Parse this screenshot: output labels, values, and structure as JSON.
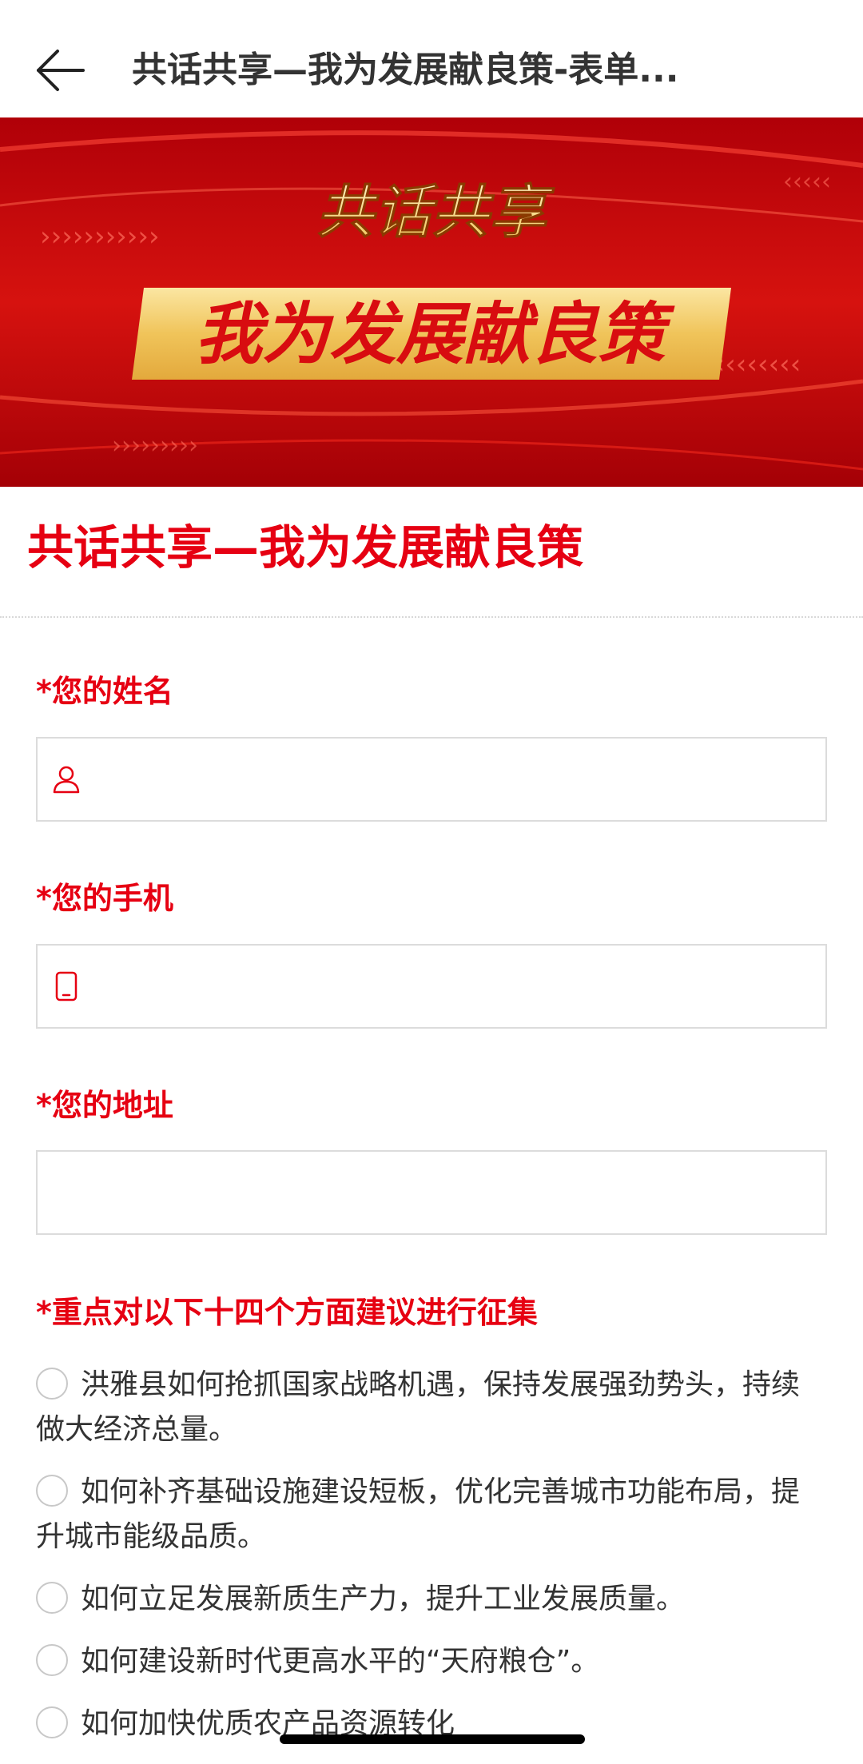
{
  "header": {
    "title": "共话共享—我为发展献良策-表单..."
  },
  "banner": {
    "line1": "共话共享",
    "line2": "我为发展献良策"
  },
  "form": {
    "heading": "共话共享—我为发展献良策",
    "fields": [
      {
        "label": "*您的姓名",
        "icon": "person-icon",
        "value": ""
      },
      {
        "label": "*您的手机",
        "icon": "phone-icon",
        "value": ""
      },
      {
        "label": "*您的地址",
        "icon": "",
        "value": ""
      }
    ],
    "question": {
      "label": "*重点对以下十四个方面建议进行征集",
      "options": [
        "洪雅县如何抢抓国家战略机遇，保持发展强劲势头，持续做大经济总量。",
        "如何补齐基础设施建设短板，优化完善城市功能布局，提升城市能级品质。",
        "如何立足发展新质生产力，提升工业发展质量。",
        "如何建设新时代更高水平的“天府粮仓”。",
        "如何加快优质农产品资源转化"
      ]
    }
  },
  "colors": {
    "accent": "#e60012",
    "banner_red": "#c4070c",
    "banner_gold": "#f3cf6a"
  }
}
